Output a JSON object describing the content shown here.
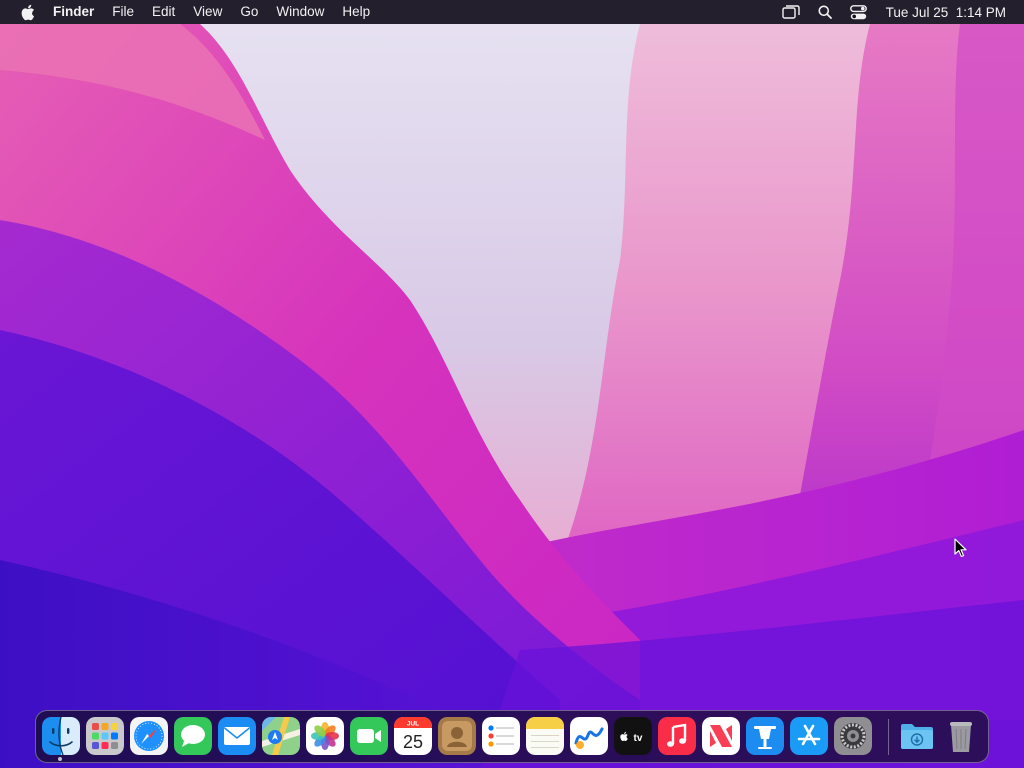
{
  "menubar": {
    "apple_icon": "apple-logo-icon",
    "app_name": "Finder",
    "menus": [
      "File",
      "Edit",
      "View",
      "Go",
      "Window",
      "Help"
    ],
    "status_icons": [
      "screen-mirroring-icon",
      "spotlight-search-icon",
      "control-center-icon"
    ],
    "clock": "Tue Jul 25  1:14 PM"
  },
  "dock": {
    "apps": [
      {
        "name": "Finder",
        "icon": "finder-icon",
        "running": true
      },
      {
        "name": "Launchpad",
        "icon": "launchpad-icon",
        "running": false
      },
      {
        "name": "Safari",
        "icon": "safari-icon",
        "running": false
      },
      {
        "name": "Messages",
        "icon": "messages-icon",
        "running": false
      },
      {
        "name": "Mail",
        "icon": "mail-icon",
        "running": false
      },
      {
        "name": "Maps",
        "icon": "maps-icon",
        "running": false
      },
      {
        "name": "Photos",
        "icon": "photos-icon",
        "running": false
      },
      {
        "name": "FaceTime",
        "icon": "facetime-icon",
        "running": false
      },
      {
        "name": "Calendar",
        "icon": "calendar-icon",
        "running": false
      },
      {
        "name": "Contacts",
        "icon": "contacts-icon",
        "running": false
      },
      {
        "name": "Reminders",
        "icon": "reminders-icon",
        "running": false
      },
      {
        "name": "Notes",
        "icon": "notes-icon",
        "running": false
      },
      {
        "name": "Freeform",
        "icon": "freeform-icon",
        "running": false
      },
      {
        "name": "TV",
        "icon": "apple-tv-icon",
        "running": false
      },
      {
        "name": "Music",
        "icon": "music-icon",
        "running": false
      },
      {
        "name": "News",
        "icon": "news-icon",
        "running": false
      },
      {
        "name": "Keynote",
        "icon": "keynote-icon",
        "running": false
      },
      {
        "name": "App Store",
        "icon": "app-store-icon",
        "running": false
      },
      {
        "name": "System Settings",
        "icon": "system-settings-icon",
        "running": false
      }
    ],
    "calendar": {
      "month": "JUL",
      "day": "25"
    },
    "tv_label": "tv",
    "stacks": [
      {
        "name": "Downloads",
        "icon": "downloads-folder-icon"
      },
      {
        "name": "Trash",
        "icon": "trash-icon"
      }
    ]
  },
  "colors": {
    "menubar_bg": "#120e1c",
    "wallpaper_sky": "#dcd6ee",
    "wallpaper_magenta": "#d52fc0",
    "wallpaper_violet": "#5a14d8",
    "wallpaper_pink": "#f08cc8"
  }
}
